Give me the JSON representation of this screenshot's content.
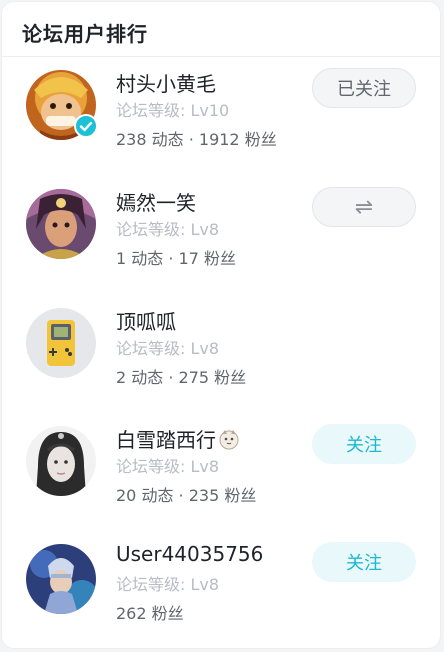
{
  "panel": {
    "title": "论坛用户排行"
  },
  "users": [
    {
      "name": "村头小黄毛",
      "level": "论坛等级: Lv10",
      "stats": "238 动态 · 1912 粉丝",
      "button": "已关注",
      "verified": true
    },
    {
      "name": "嫣然一笑",
      "level": "论坛等级: Lv8",
      "stats": "1 动态 · 17 粉丝",
      "button": "⇌",
      "verified": false
    },
    {
      "name": "顶呱呱",
      "level": "论坛等级: Lv8",
      "stats": "2 动态 · 275 粉丝",
      "button": "",
      "verified": false
    },
    {
      "name": "白雪踏西行",
      "level": "论坛等级: Lv8",
      "stats": "20 动态 · 235 粉丝",
      "button": "关注",
      "verified": false
    },
    {
      "name": "User44035756",
      "level": "论坛等级: Lv8",
      "stats": "262 粉丝",
      "button": "关注",
      "verified": false
    }
  ],
  "colors": {
    "accent": "#1cb8d0",
    "verified_badge": "#1cc1d6"
  },
  "icons": {
    "verified": "check-badge-icon",
    "mutual": "mutual-follow-icon"
  }
}
